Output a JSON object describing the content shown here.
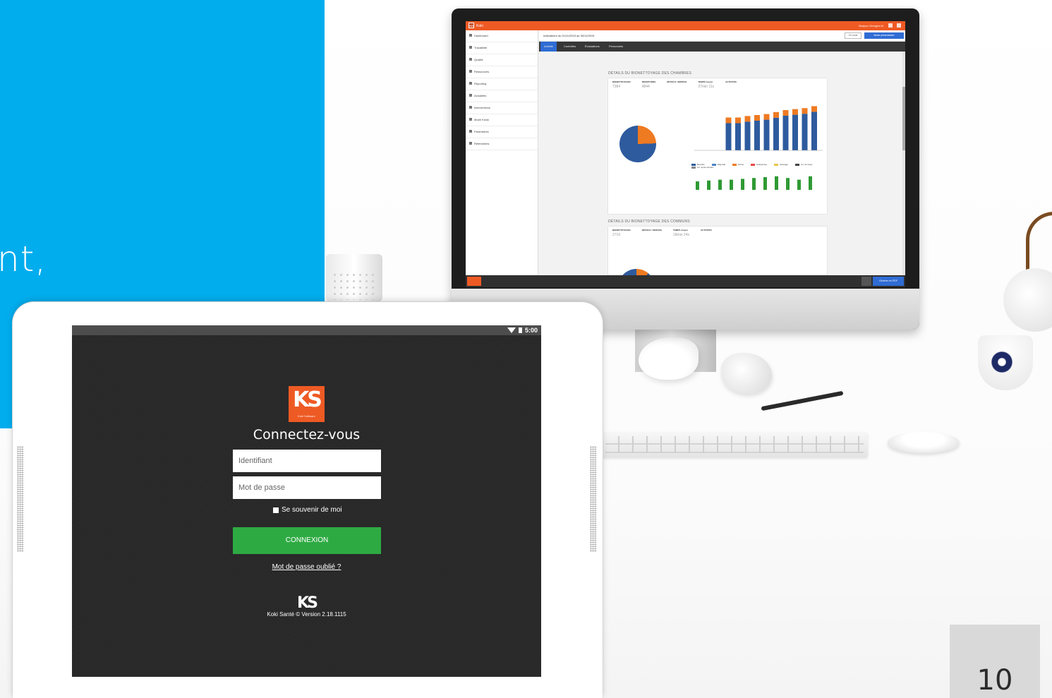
{
  "slide": {
    "blue_text": "nt,",
    "page_number": "10",
    "accent_color": "#02adee"
  },
  "desktop_app": {
    "app_name": "Koki",
    "user": "Bonjour Georges M.",
    "sidebar": [
      {
        "label": "Dashboard",
        "icon": "home-icon"
      },
      {
        "label": "Tracabilité",
        "icon": "list-icon"
      },
      {
        "label": "Qualité",
        "icon": "star-icon"
      },
      {
        "label": "Ressources",
        "icon": "users-icon"
      },
      {
        "label": "Reporting",
        "icon": "chart-icon"
      },
      {
        "label": "Actualités",
        "icon": "news-icon"
      },
      {
        "label": "Interventions",
        "icon": "tool-icon"
      },
      {
        "label": "Mode Kiosk",
        "icon": "tablet-icon"
      },
      {
        "label": "Paramètres",
        "icon": "gear-icon"
      },
      {
        "label": "Référentiels",
        "icon": "book-icon"
      }
    ],
    "filter_text": "Indicateurs du 01/11/2015 au 30/11/2015",
    "export_label": "Ce mois",
    "present_label": "Mode présentation",
    "tabs": [
      "Activité",
      "Contrôles",
      "Évaluations",
      "Personnels"
    ],
    "section1": {
      "title": "DÉTAILS DU BIONETTOYAGE DES CHAMBRES",
      "kpis": [
        {
          "label": "BIONETTOYAGES",
          "value": "7384"
        },
        {
          "label": "RÉCEPTIONS",
          "value": "4844"
        },
        {
          "label": "DÉTAILS / SERVICE",
          "value": ""
        },
        {
          "label": "TEMPS moyen",
          "value": "27min 11s"
        },
        {
          "label": "ACTIVITÉS",
          "value": ""
        }
      ],
      "legend": [
        "Bouclés",
        "Dégradé",
        "Refus",
        "Suspendus",
        "Sauvage",
        "Arr. de traçé",
        "Arr. après travaux"
      ]
    },
    "section2": {
      "title": "DÉTAILS DU BIONETTOYAGE DES COMMUNS",
      "kpis": [
        {
          "label": "BIONETTOYAGES",
          "value": "2716"
        },
        {
          "label": "DÉTAILS / SERVICE",
          "value": ""
        },
        {
          "label": "TEMPS moyen",
          "value": "18min 24s"
        },
        {
          "label": "ACTIVITÉS",
          "value": ""
        }
      ]
    },
    "pdf_label": "Générer en PDF",
    "colors": {
      "brand": "#ee5a24",
      "primary": "#2f6cd4",
      "series_blue": "#2e5b9e",
      "series_orange": "#ee7a22",
      "series_green": "#2f9a34"
    }
  },
  "tablet_app": {
    "status_time": "5:00",
    "logo_letters": "KS",
    "logo_caption": "Koki Software",
    "title": "Connectez-vous",
    "username_placeholder": "Identifiant",
    "password_placeholder": "Mot de passe",
    "remember_label": "Se souvenir de moi",
    "login_button": "CONNEXION",
    "forgot_link": "Mot de passe oublié ?",
    "footer_logo": "KS",
    "version": "Koki Santé © Version 2.18.1115",
    "colors": {
      "button": "#2eaa43",
      "logo": "#ee5a24",
      "background": "#282828"
    }
  }
}
